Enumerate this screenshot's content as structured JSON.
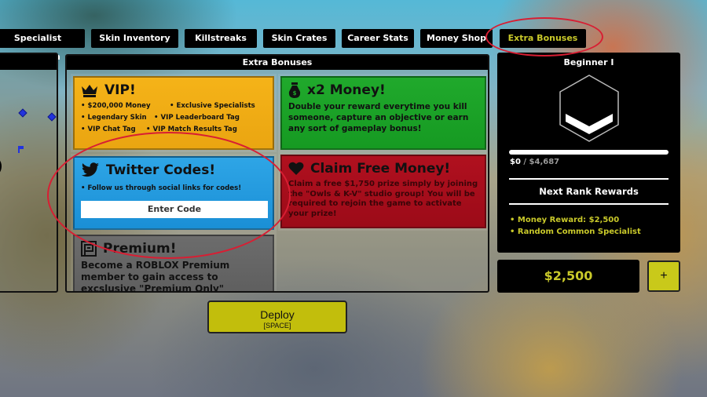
{
  "nav": {
    "tabs": [
      {
        "label": "Specialist Selection",
        "active": false
      },
      {
        "label": "Skin Inventory",
        "active": false
      },
      {
        "label": "Killstreaks",
        "active": false
      },
      {
        "label": "Skin Crates",
        "active": false
      },
      {
        "label": "Career Stats",
        "active": false
      },
      {
        "label": "Money Shop",
        "active": false
      },
      {
        "label": "Extra Bonuses",
        "active": true
      }
    ]
  },
  "main": {
    "title": "Extra Bonuses",
    "cards": {
      "vip": {
        "icon": "crown-icon",
        "title": "VIP!",
        "perks": [
          "$200,000 Money",
          "Exclusive Specialists",
          "Legendary Skin",
          "VIP Leaderboard Tag",
          "VIP Chat Tag",
          "VIP Match Results Tag"
        ]
      },
      "money": {
        "icon": "money-bag-icon",
        "title": "x2 Money!",
        "body": "Double your reward everytime you kill someone, capture an objective or earn any sort of gameplay bonus!"
      },
      "twitter": {
        "icon": "twitter-bird-icon",
        "title": "Twitter Codes!",
        "body": "• Follow us through social links for codes!",
        "button_label": "Enter Code"
      },
      "claim": {
        "icon": "heart-icon",
        "title": "Claim Free Money!",
        "body": "Claim a free $1,750 prize simply by joining the \"Owls & K-V\" studio group! You will be required to rejoin the game to activate your prize!"
      },
      "premium": {
        "icon": "roblox-premium-icon",
        "title": "Premium!",
        "body": "Become a ROBLOX Premium member to gain access to excslusive \"Premium Only\" specialists!"
      }
    }
  },
  "rank": {
    "name": "Beginner I",
    "progress_current": "$0",
    "progress_separator": " / ",
    "progress_max": "$4,687",
    "progress_fraction": 0,
    "next_rewards_title": "Next Rank Rewards",
    "rewards": [
      "• Money Reward: $2,500",
      "• Random Common Specialist"
    ]
  },
  "wallet": {
    "balance": "$2,500",
    "add_label": "+"
  },
  "deploy": {
    "label": "Deploy",
    "hotkey": "[SPACE]"
  },
  "colors": {
    "accent_yellow": "#c9c92a",
    "vip_orange": "#f5b318",
    "money_green": "#20a92c",
    "twitter_blue": "#2ea5e6",
    "claim_red": "#b0101f",
    "premium_gray": "#6c6c6c",
    "annotation_red": "#d81e33"
  }
}
